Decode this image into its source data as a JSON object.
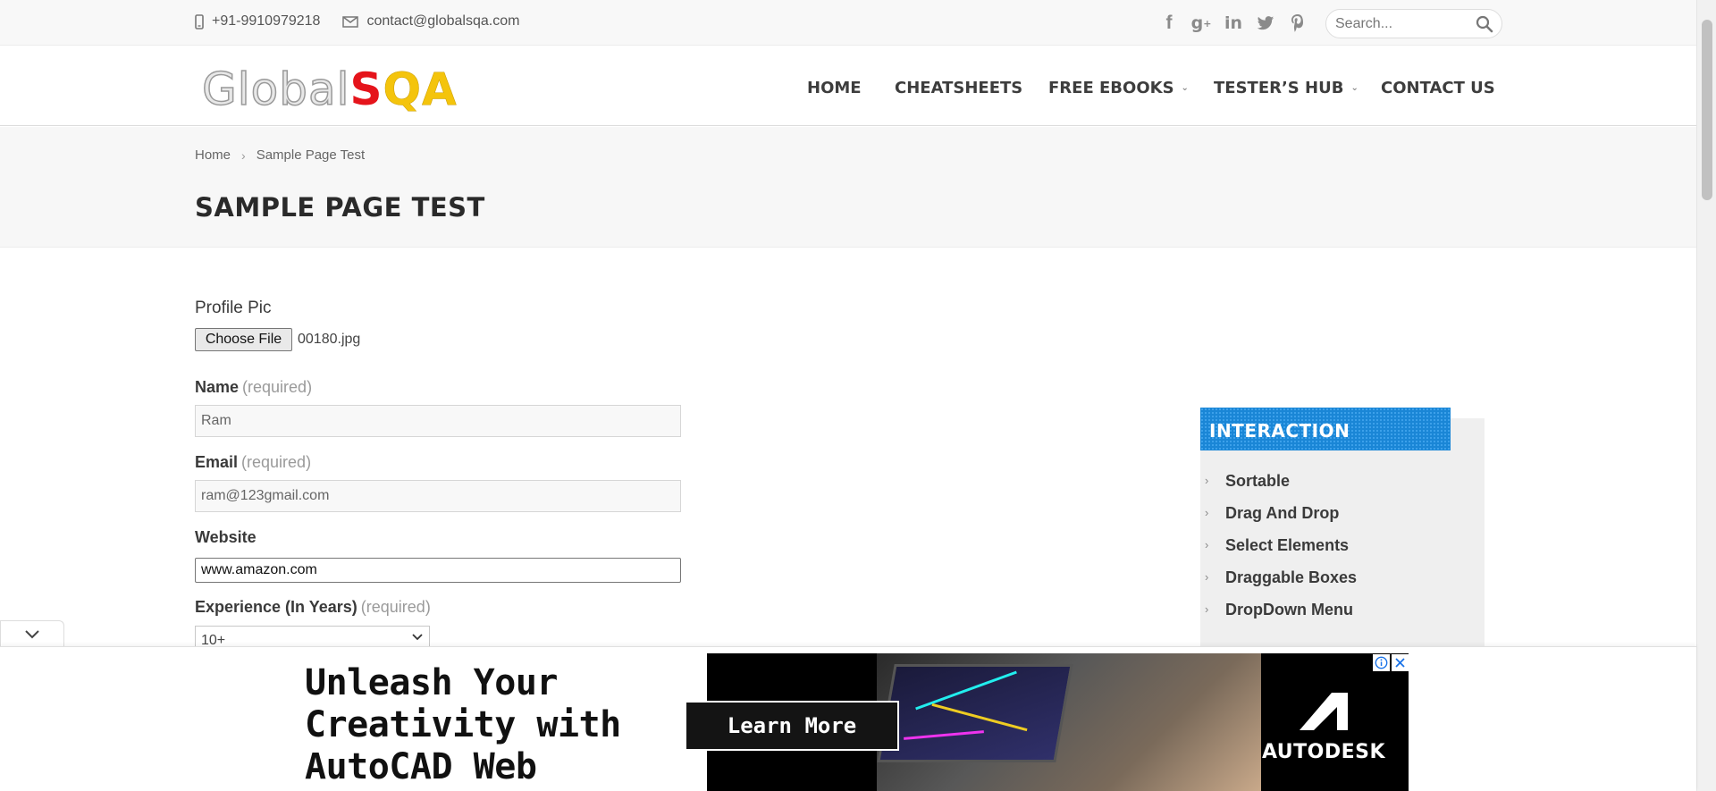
{
  "topbar": {
    "phone": "+91-9910979218",
    "email": "contact@globalsqa.com",
    "social": [
      "facebook-icon",
      "google-plus-icon",
      "linkedin-icon",
      "twitter-icon",
      "pinterest-icon"
    ],
    "search_placeholder": "Search..."
  },
  "logo": {
    "part1": "Global",
    "part2": "S",
    "part3": "QA"
  },
  "nav": {
    "home": "HOME",
    "cheatsheets": "CHEATSHEETS",
    "ebooks": "FREE EBOOKS",
    "testers_hub": "TESTER’S HUB",
    "contact": "CONTACT US"
  },
  "breadcrumb": {
    "home": "Home",
    "current": "Sample Page Test"
  },
  "page_title": "SAMPLE PAGE TEST",
  "form": {
    "profile_pic_label": "Profile Pic",
    "choose_file_label": "Choose File",
    "file_name": "00180.jpg",
    "name_label": "Name",
    "name_required": "(required)",
    "name_value": "Ram",
    "email_label": "Email",
    "email_required": "(required)",
    "email_value": "ram@123gmail.com",
    "website_label": "Website",
    "website_value": "www.amazon.com",
    "experience_label": "Experience (In Years)",
    "experience_required": "(required)",
    "experience_value": "10+"
  },
  "sidebar": {
    "title": "INTERACTION",
    "items": [
      "Sortable",
      "Drag And Drop",
      "Select Elements",
      "Draggable Boxes",
      "DropDown Menu"
    ]
  },
  "ad": {
    "headline_1": "Unleash Your",
    "headline_2": "Creativity with",
    "headline_3": "AutoCAD Web",
    "cta": "Learn More",
    "brand": "AUTODESK"
  },
  "colors": {
    "widget_title_bg": "#1a86d6",
    "logo_red": "#e5141b",
    "logo_yellow": "#f4c40c"
  }
}
